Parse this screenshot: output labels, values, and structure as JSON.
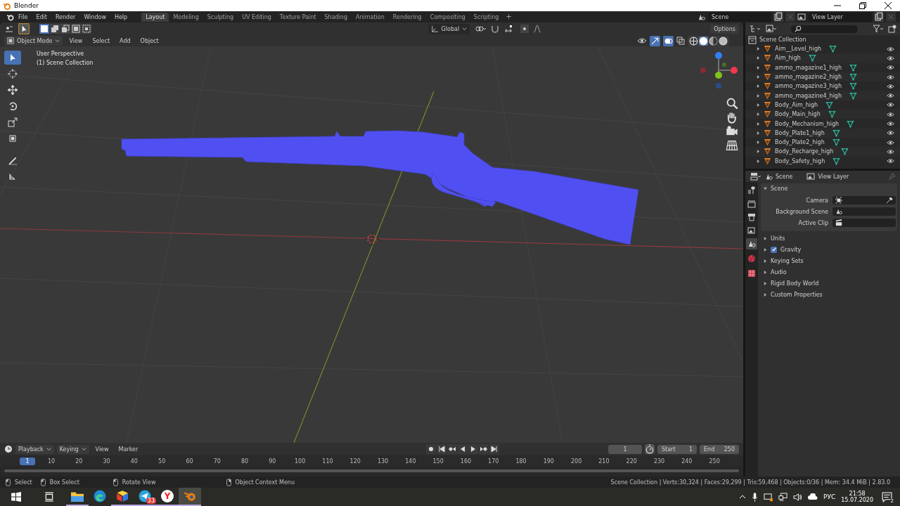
{
  "window": {
    "title": "Blender"
  },
  "menu": [
    "File",
    "Edit",
    "Render",
    "Window",
    "Help"
  ],
  "workspaces": [
    {
      "label": "Layout",
      "selected": true
    },
    {
      "label": "Modeling",
      "selected": false
    },
    {
      "label": "Sculpting",
      "selected": false
    },
    {
      "label": "UV Editing",
      "selected": false
    },
    {
      "label": "Texture Paint",
      "selected": false
    },
    {
      "label": "Shading",
      "selected": false
    },
    {
      "label": "Animation",
      "selected": false
    },
    {
      "label": "Rendering",
      "selected": false
    },
    {
      "label": "Compositing",
      "selected": false
    },
    {
      "label": "Scripting",
      "selected": false
    }
  ],
  "add_workspace": "+",
  "scene": "Scene",
  "view_layer": "View Layer",
  "tool_header": {
    "orientation": "Global",
    "options": "Options"
  },
  "viewport_header": {
    "mode": "Object Mode",
    "menus": [
      "View",
      "Select",
      "Add",
      "Object"
    ],
    "shading": [
      {
        "kind": "wire",
        "selected": false
      },
      {
        "kind": "solid",
        "selected": true
      },
      {
        "kind": "material",
        "selected": false
      },
      {
        "kind": "rendered",
        "selected": false
      }
    ]
  },
  "viewport": {
    "overlay_lines": [
      "User Perspective",
      "(1) Scene Collection"
    ],
    "tools": [
      {
        "kind": "select",
        "selected": true
      },
      {
        "kind": "cursor",
        "selected": false
      },
      {
        "kind": "move",
        "selected": false
      },
      {
        "kind": "rotate",
        "selected": false
      },
      {
        "kind": "scale",
        "selected": false
      },
      {
        "kind": "transform",
        "selected": false
      },
      {
        "kind": "annotate",
        "selected": false
      },
      {
        "kind": "measure",
        "selected": false
      }
    ]
  },
  "outliner": {
    "root": "Scene Collection",
    "items": [
      {
        "name": "Aim__Level_high"
      },
      {
        "name": "Aim_high"
      },
      {
        "name": "ammo_magazine1_high"
      },
      {
        "name": "ammo_magazine2_high"
      },
      {
        "name": "ammo_magazine3_high"
      },
      {
        "name": "ammo_magazine4_high"
      },
      {
        "name": "Body_Aim_high"
      },
      {
        "name": "Body_Main_high"
      },
      {
        "name": "Body_Mechanism_high"
      },
      {
        "name": "Body_Plate1_high"
      },
      {
        "name": "Body_Plate2_high"
      },
      {
        "name": "Body_Recharge_high"
      },
      {
        "name": "Body_Safety_high"
      }
    ]
  },
  "properties": {
    "tabs": [
      {
        "kind": "tool",
        "selected": false
      },
      {
        "kind": "render",
        "selected": false
      },
      {
        "kind": "output",
        "selected": false
      },
      {
        "kind": "view_layer",
        "selected": false
      },
      {
        "kind": "scene",
        "selected": true
      },
      {
        "kind": "world",
        "selected": false
      },
      {
        "kind": "texture",
        "selected": false
      }
    ],
    "breadcrumbs": [
      "Scene",
      "View Layer"
    ],
    "panel": {
      "title": "Scene",
      "expanded": true,
      "fields": [
        {
          "label": "Camera",
          "kind": "camera"
        },
        {
          "label": "Background Scene",
          "kind": "scene"
        },
        {
          "label": "Active Clip",
          "kind": "clip"
        }
      ]
    },
    "sections": [
      {
        "label": "Units",
        "kind": "plain"
      },
      {
        "label": "Gravity",
        "kind": "checkbox",
        "checked": true
      },
      {
        "label": "Keying Sets",
        "kind": "plain"
      },
      {
        "label": "Audio",
        "kind": "plain"
      },
      {
        "label": "Rigid Body World",
        "kind": "plain"
      },
      {
        "label": "Custom Properties",
        "kind": "plain"
      }
    ]
  },
  "timeline": {
    "menus": [
      {
        "label": "Playback",
        "dropdown": true
      },
      {
        "label": "Keying",
        "dropdown": true
      },
      {
        "label": "View",
        "dropdown": false
      },
      {
        "label": "Marker",
        "dropdown": false
      }
    ],
    "current_frame": "1",
    "start_label": "Start",
    "start": "1",
    "end_label": "End",
    "end": "250",
    "playhead": "1",
    "ticks": [
      "10",
      "20",
      "30",
      "40",
      "50",
      "60",
      "70",
      "80",
      "90",
      "100",
      "110",
      "120",
      "130",
      "140",
      "150",
      "160",
      "170",
      "180",
      "190",
      "200",
      "210",
      "220",
      "230",
      "240",
      "250"
    ]
  },
  "status_bar": {
    "hints": [
      "Select",
      "Box Select",
      "Rotate View",
      "Object Context Menu"
    ],
    "stats": "Scene Collection | Verts:30,324 | Faces:29,299 | Tris:59,468 | Objects:0/36 | Mem: 34.4 MiB | 2.83.0"
  },
  "taskbar": {
    "apps": [
      {
        "kind": "explorer",
        "running": true,
        "selected": false
      },
      {
        "kind": "edge",
        "running": false,
        "selected": false
      },
      {
        "kind": "cube",
        "running": true,
        "selected": false
      },
      {
        "kind": "telegram",
        "running": true,
        "selected": false,
        "badge": "33"
      },
      {
        "kind": "yandex",
        "running": true,
        "selected": false,
        "glyph": "Y"
      },
      {
        "kind": "blender",
        "running": true,
        "selected": true
      }
    ],
    "language": "РУС",
    "time": "21:58",
    "date": "15.07.2020",
    "notifications": "2"
  }
}
